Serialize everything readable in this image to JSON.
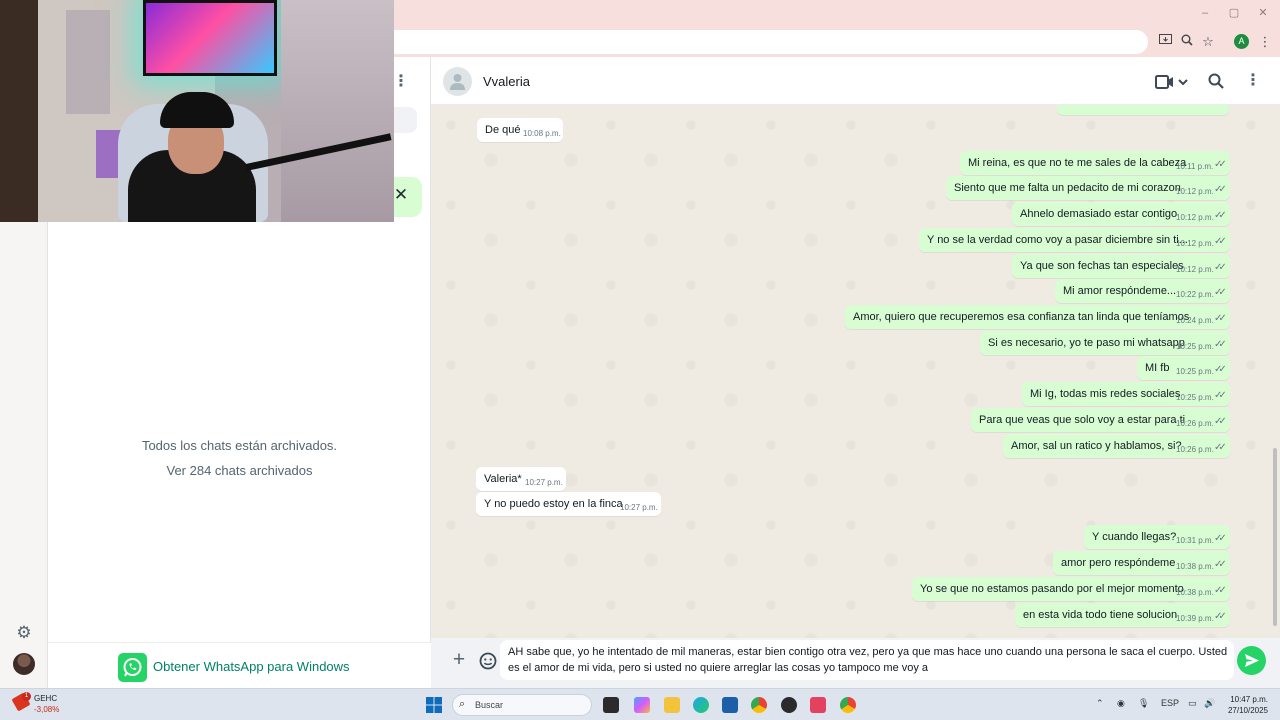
{
  "browser": {
    "window_controls": [
      "–",
      "▢",
      "✕"
    ],
    "profile_initial": "A"
  },
  "sidebar": {
    "archived_title": "Todos los chats están archivados.",
    "archived_link": "Ver 284 chats archivados",
    "get_app_label": "Obtener WhatsApp para Windows"
  },
  "chat": {
    "contact_name": "Vvaleria",
    "messages": [
      {
        "dir": "in",
        "text": "De qué",
        "time": "10:08 p.m."
      },
      {
        "dir": "out",
        "text": "Mi reina, es que no te me sales de la cabeza",
        "time": "10:11 p.m."
      },
      {
        "dir": "out",
        "text": "Siento que me falta un pedacito de mi corazon",
        "time": "10:12 p.m."
      },
      {
        "dir": "out",
        "text": "Ahnelo demasiado estar contigo",
        "time": "10:12 p.m."
      },
      {
        "dir": "out",
        "text": "Y no se la verdad como voy a pasar diciembre sin ti...",
        "time": "10:12 p.m."
      },
      {
        "dir": "out",
        "text": "Ya que son fechas tan especiales",
        "time": "10:12 p.m."
      },
      {
        "dir": "out",
        "text": "Mi amor respóndeme...",
        "time": "10:22 p.m."
      },
      {
        "dir": "out",
        "text": "Amor, quiero que recuperemos esa confianza tan linda que teníamos",
        "time": "10:24 p.m."
      },
      {
        "dir": "out",
        "text": "Si es necesario, yo te paso mi whatsapp",
        "time": "10:25 p.m."
      },
      {
        "dir": "out",
        "text": "MI fb",
        "time": "10:25 p.m."
      },
      {
        "dir": "out",
        "text": "Mi Ig, todas mis redes sociales",
        "time": "10:25 p.m."
      },
      {
        "dir": "out",
        "text": "Para que veas que solo voy a estar para ti",
        "time": "10:26 p.m."
      },
      {
        "dir": "out",
        "text": "Amor, sal un ratico y hablamos, si?",
        "time": "10:26 p.m."
      },
      {
        "dir": "in",
        "text": "Valeria*",
        "time": "10:27 p.m."
      },
      {
        "dir": "in",
        "text": "Y no puedo estoy en la finca",
        "time": "10:27 p.m."
      },
      {
        "dir": "out",
        "text": "Y cuando llegas?",
        "time": "10:31 p.m."
      },
      {
        "dir": "out",
        "text": "amor pero respóndeme",
        "time": "10:38 p.m."
      },
      {
        "dir": "out",
        "text": "Yo se que no estamos pasando por el mejor momento",
        "time": "10:38 p.m."
      },
      {
        "dir": "out",
        "text": "en esta vida todo tiene solucion",
        "time": "10:39 p.m."
      }
    ],
    "read_ticks": "✓✓",
    "compose_text": "AH sabe que, yo  he intentado de mil maneras, estar bien contigo otra vez, pero ya que mas hace uno cuando una persona le saca el cuerpo. Usted es el amor de mi vida, pero si usted no quiere arreglar las cosas yo tampoco me voy a"
  },
  "taskbar": {
    "stock_name": "GEHC",
    "stock_change": "-3,08%",
    "stock_badge": "1",
    "search_placeholder": "Buscar",
    "language": "ESP",
    "time": "10:47 p.m.",
    "date": "27/10/2025"
  },
  "colors": {
    "outgoing_bubble": "#d9fdd3",
    "incoming_bubble": "#ffffff",
    "accent": "#25d366",
    "chat_background": "#efeae2"
  }
}
